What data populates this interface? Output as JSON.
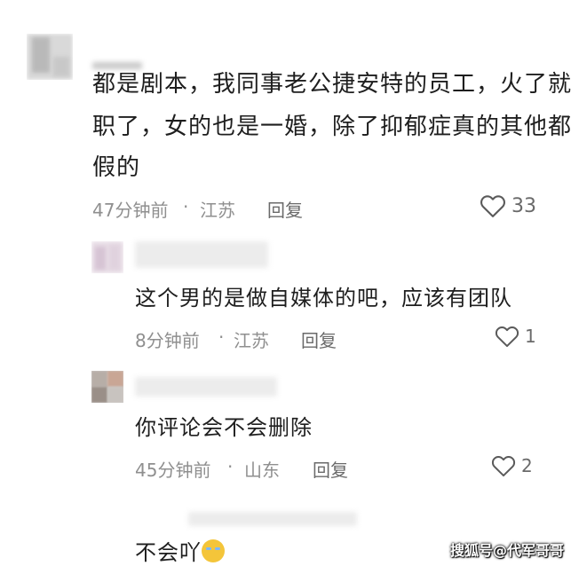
{
  "comments": [
    {
      "text_lines": [
        "都是剧本，我同事老公捷安特的员工，火了就",
        "职了，女的也是一婚，除了抑郁症真的其他都",
        "假的"
      ],
      "time": "47分钟前",
      "sep": "·",
      "location": "江苏",
      "reply_label": "回复",
      "likes": "33"
    },
    {
      "text": "这个男的是做自媒体的吧，应该有团队",
      "time": "8分钟前",
      "sep": "·",
      "location": "江苏",
      "reply_label": "回复",
      "likes": "1"
    },
    {
      "text": "你评论会不会删除",
      "time": "45分钟前",
      "sep": "·",
      "location": "山东",
      "reply_label": "回复",
      "likes": "2"
    },
    {
      "text": "不会吖"
    }
  ],
  "watermark": "搜狐号@代军哥哥",
  "icons": {
    "like": "heart-outline-icon",
    "emoji": "laughing-crying-emoji-icon"
  },
  "colors": {
    "background": "#ffffff",
    "text": "#1e1e1e",
    "meta": "#8f8f8f"
  }
}
